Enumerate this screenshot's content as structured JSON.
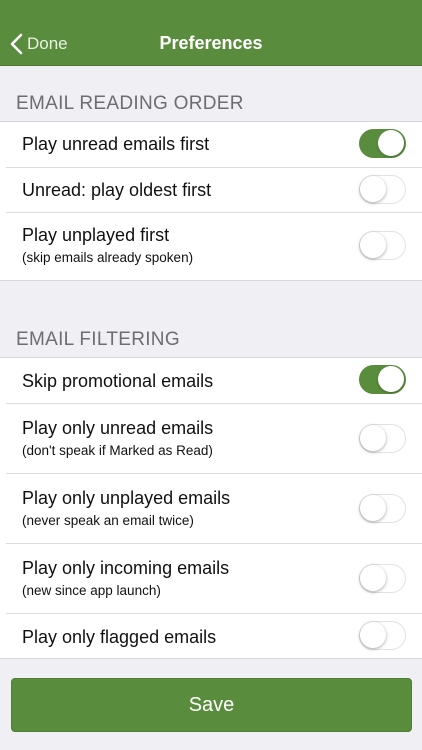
{
  "nav": {
    "back_label": "Done",
    "title": "Preferences"
  },
  "sections": [
    {
      "header": "EMAIL READING ORDER",
      "rows": [
        {
          "label": "Play unread emails first",
          "sub": "",
          "on": true
        },
        {
          "label": "Unread: play oldest first",
          "sub": "",
          "on": false
        },
        {
          "label": "Play unplayed first",
          "sub": "(skip emails already spoken)",
          "on": false
        }
      ]
    },
    {
      "header": "EMAIL FILTERING",
      "rows": [
        {
          "label": "Skip promotional emails",
          "sub": "",
          "on": true
        },
        {
          "label": "Play only unread emails",
          "sub": "(don't speak if Marked as Read)",
          "on": false
        },
        {
          "label": "Play only unplayed emails",
          "sub": "(never speak an email twice)",
          "on": false
        },
        {
          "label": "Play only incoming emails",
          "sub": "(new since app launch)",
          "on": false
        },
        {
          "label": "Play only flagged emails",
          "sub": "",
          "on": false
        }
      ]
    }
  ],
  "save_label": "Save",
  "colors": {
    "accent": "#5a8c3e",
    "background": "#efeff4"
  }
}
